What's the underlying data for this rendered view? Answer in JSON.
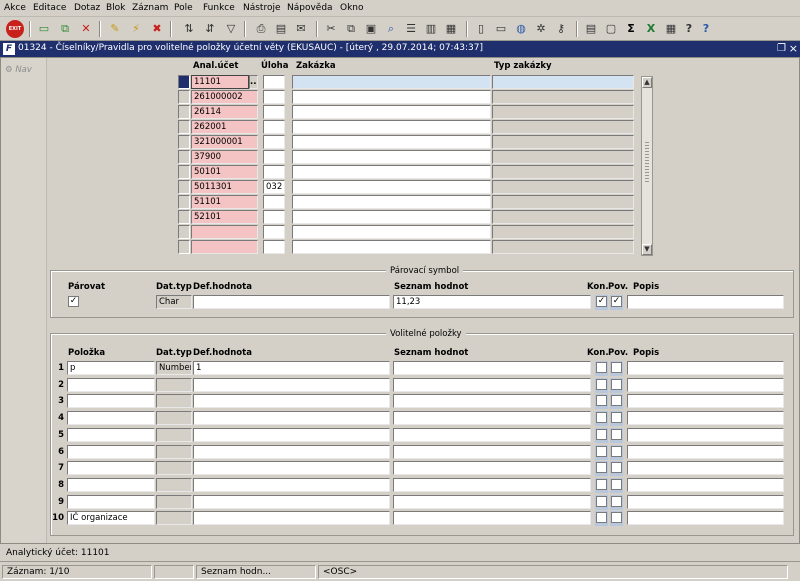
{
  "menu": [
    "Akce",
    "Editace",
    "Dotaz",
    "Blok",
    "Záznam",
    "Pole",
    "Funkce",
    "Nástroje",
    "Nápověda",
    "Okno"
  ],
  "toolbar": {
    "exit_label": "EXIT"
  },
  "window": {
    "title": "01324 - Číselníky/Pravidla pro volitelné položky účetní věty (EKUSAUC) - [úterý  , 29.07.2014; 07:43:37]",
    "icon_letter": "F"
  },
  "nav": {
    "label": "Nav"
  },
  "grid": {
    "headers": {
      "anal_ucet": "Anal.účet",
      "uloha": "Úloha",
      "zakazka": "Zakázka",
      "typ_zakazky": "Typ zakázky"
    },
    "lov_label": "...",
    "rows": [
      {
        "anal_ucet": "11101",
        "uloha": ""
      },
      {
        "anal_ucet": "261000002",
        "uloha": ""
      },
      {
        "anal_ucet": "26114",
        "uloha": ""
      },
      {
        "anal_ucet": "262001",
        "uloha": ""
      },
      {
        "anal_ucet": "321000001",
        "uloha": ""
      },
      {
        "anal_ucet": "37900",
        "uloha": ""
      },
      {
        "anal_ucet": "50101",
        "uloha": ""
      },
      {
        "anal_ucet": "5011301",
        "uloha": "032"
      },
      {
        "anal_ucet": "51101",
        "uloha": ""
      },
      {
        "anal_ucet": "52101",
        "uloha": ""
      },
      {
        "anal_ucet": "",
        "uloha": ""
      },
      {
        "anal_ucet": "",
        "uloha": ""
      }
    ]
  },
  "parovaci": {
    "title": "Párovací symbol",
    "headers": {
      "parovat": "Párovat",
      "dat_typ": "Dat.typ",
      "def_hodnota": "Def.hodnota",
      "seznam_hodnot": "Seznam hodnot",
      "kon": "Kon.",
      "pov": "Pov.",
      "popis": "Popis"
    },
    "row": {
      "parovat_mark": "✓",
      "dat_typ": "Char",
      "def_hodnota": "",
      "seznam_hodnot": "11,23",
      "kon_mark": "✓",
      "pov_mark": "✓",
      "popis": ""
    }
  },
  "volitelne": {
    "title": "Volitelné položky",
    "headers": {
      "polozka": "Položka",
      "dat_typ": "Dat.typ",
      "def_hodnota": "Def.hodnota",
      "seznam_hodnot": "Seznam hodnot",
      "kon": "Kon.",
      "pov": "Pov.",
      "popis": "Popis"
    },
    "rows": [
      {
        "num": "1",
        "polozka": "p",
        "dat_typ": "Number",
        "def_hodnota": "1",
        "seznam_hodnot": "",
        "popis": ""
      },
      {
        "num": "2",
        "polozka": "",
        "dat_typ": "",
        "def_hodnota": "",
        "seznam_hodnot": "",
        "popis": ""
      },
      {
        "num": "3",
        "polozka": "",
        "dat_typ": "",
        "def_hodnota": "",
        "seznam_hodnot": "",
        "popis": ""
      },
      {
        "num": "4",
        "polozka": "",
        "dat_typ": "",
        "def_hodnota": "",
        "seznam_hodnot": "",
        "popis": ""
      },
      {
        "num": "5",
        "polozka": "",
        "dat_typ": "",
        "def_hodnota": "",
        "seznam_hodnot": "",
        "popis": ""
      },
      {
        "num": "6",
        "polozka": "",
        "dat_typ": "",
        "def_hodnota": "",
        "seznam_hodnot": "",
        "popis": ""
      },
      {
        "num": "7",
        "polozka": "",
        "dat_typ": "",
        "def_hodnota": "",
        "seznam_hodnot": "",
        "popis": ""
      },
      {
        "num": "8",
        "polozka": "",
        "dat_typ": "",
        "def_hodnota": "",
        "seznam_hodnot": "",
        "popis": ""
      },
      {
        "num": "9",
        "polozka": "",
        "dat_typ": "",
        "def_hodnota": "",
        "seznam_hodnot": "",
        "popis": ""
      },
      {
        "num": "10",
        "polozka": "IČ organizace",
        "dat_typ": "",
        "def_hodnota": "",
        "seznam_hodnot": "",
        "popis": ""
      }
    ]
  },
  "hint": "Analytický účet: 11101",
  "status": {
    "record": "Záznam: 1/10",
    "field": "Seznam hodn...",
    "mode": "<OSC>"
  }
}
